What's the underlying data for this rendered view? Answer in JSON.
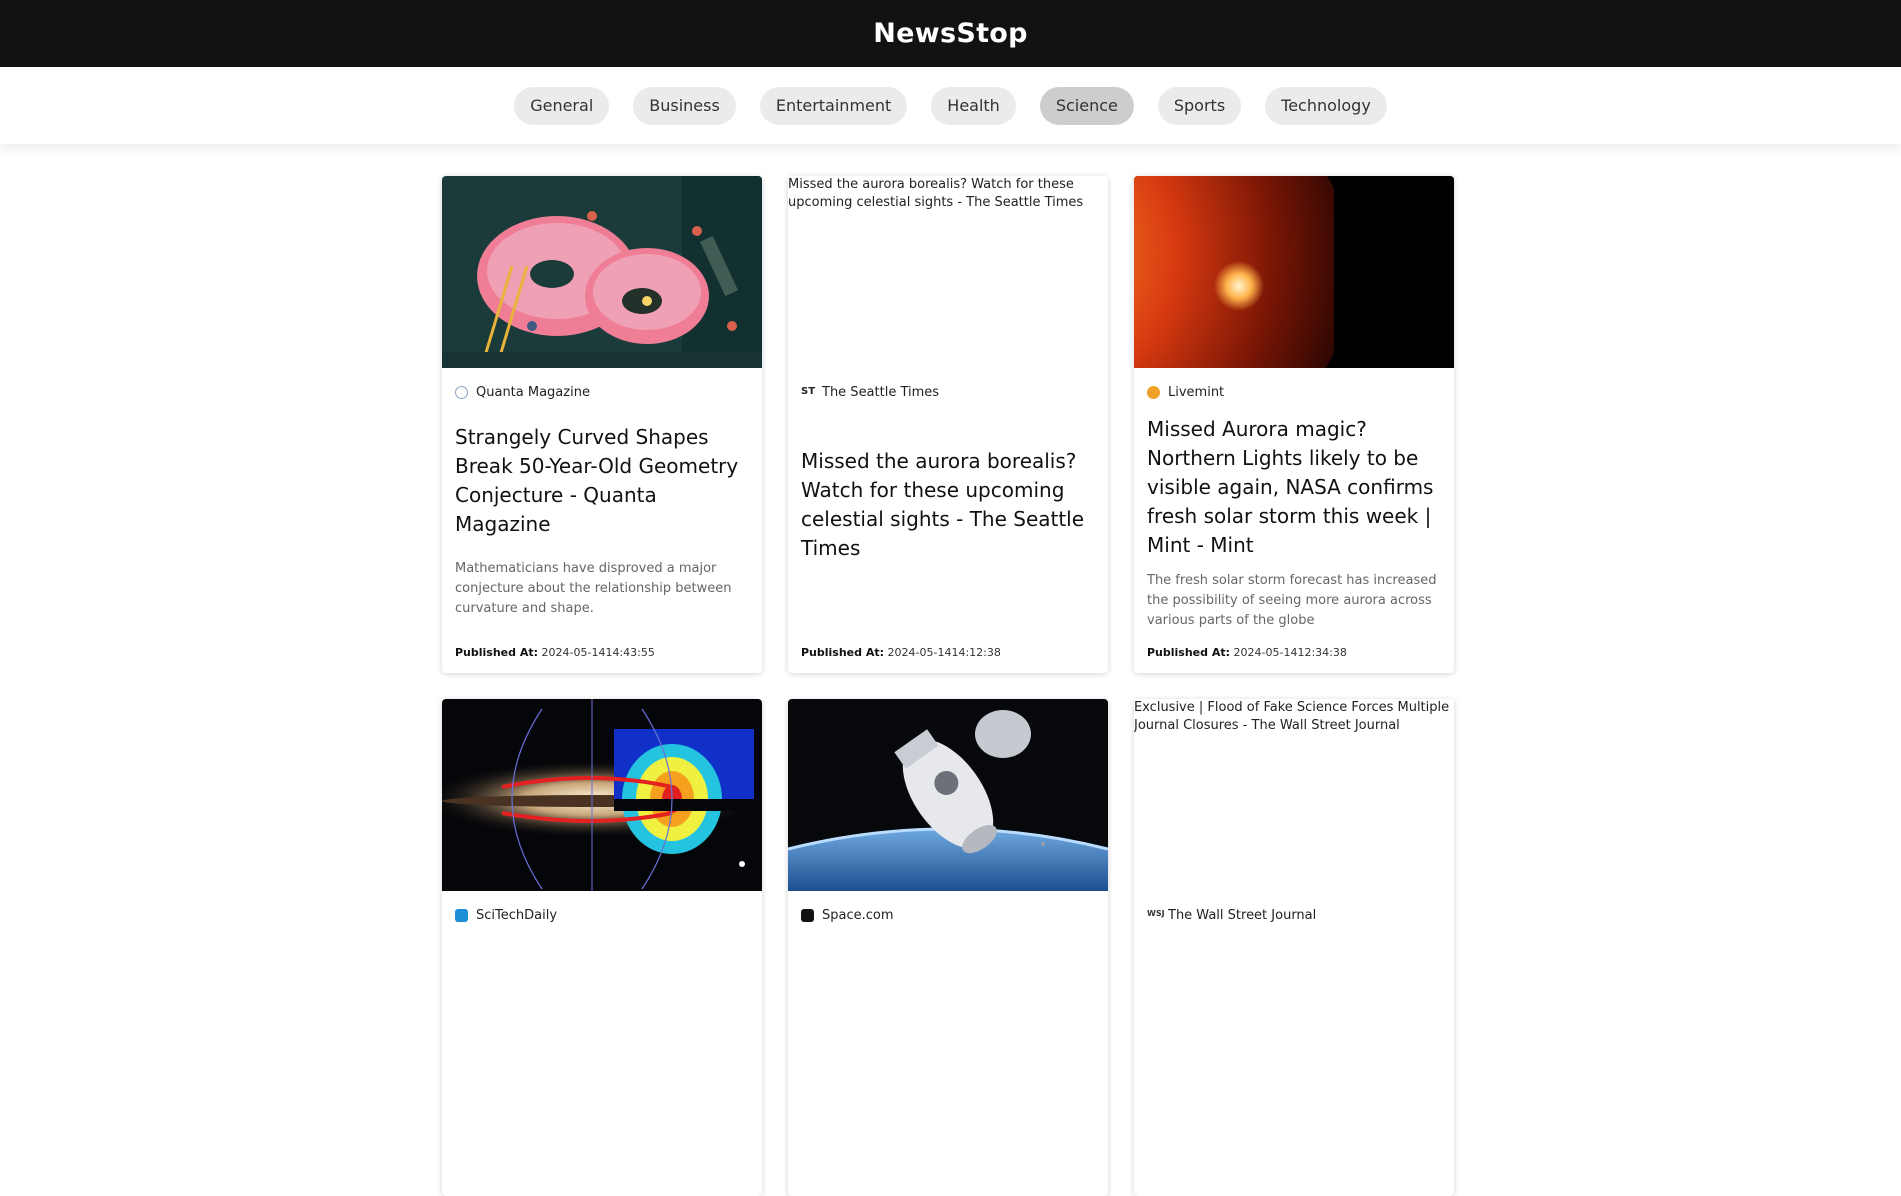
{
  "brand": "NewsStop",
  "categories": [
    "General",
    "Business",
    "Entertainment",
    "Health",
    "Science",
    "Sports",
    "Technology"
  ],
  "active_category": "Science",
  "published_label": "Published At:",
  "articles": [
    {
      "source": "Quanta Magazine",
      "favicon": "globe-icon",
      "image_alt": "",
      "title": "Strangely Curved Shapes Break 50-Year-Old Geometry Conjecture - Quanta Magazine",
      "description": "Mathematicians have disproved a major conjecture about the relationship between curvature and shape.",
      "published": "2024-05-1414:43:55"
    },
    {
      "source": "The Seattle Times",
      "favicon": "st-logo-icon",
      "image_alt": "Missed the aurora borealis? Watch for these upcoming celestial sights - The Seattle Times",
      "title": "Missed the aurora borealis? Watch for these upcoming celestial sights - The Seattle Times",
      "description": "",
      "published": "2024-05-1414:12:38"
    },
    {
      "source": "Livemint",
      "favicon": "mint-logo-icon",
      "image_alt": "",
      "title": "Missed Aurora magic? Northern Lights likely to be visible again, NASA confirms fresh solar storm this week | Mint - Mint",
      "description": "The fresh solar storm forecast has increased the possibility of seeing more aurora across various parts of the globe",
      "published": "2024-05-1412:34:38"
    },
    {
      "source": "SciTechDaily",
      "favicon": "s-logo-icon",
      "image_alt": "",
      "title": "",
      "description": "",
      "published": ""
    },
    {
      "source": "Space.com",
      "favicon": "space-logo-icon",
      "image_alt": "",
      "title": "",
      "description": "",
      "published": ""
    },
    {
      "source": "The Wall Street Journal",
      "favicon": "wsj-logo-icon",
      "image_alt": "Exclusive | Flood of Fake Science Forces Multiple Journal Closures - The Wall Street Journal",
      "title": "",
      "description": "",
      "published": ""
    }
  ]
}
